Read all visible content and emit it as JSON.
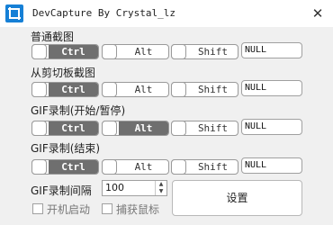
{
  "window": {
    "title": "DevCapture By Crystal_lz",
    "close_glyph": "✕"
  },
  "sections": [
    {
      "label": "普通截图",
      "keys": [
        {
          "label": "Ctrl",
          "on": true
        },
        {
          "label": "Alt",
          "on": false
        },
        {
          "label": "Shift",
          "on": false
        }
      ],
      "key_value": "NULL"
    },
    {
      "label": "从剪切板截图",
      "keys": [
        {
          "label": "Ctrl",
          "on": true
        },
        {
          "label": "Alt",
          "on": false
        },
        {
          "label": "Shift",
          "on": false
        }
      ],
      "key_value": "NULL"
    },
    {
      "label": "GIF录制(开始/暂停)",
      "keys": [
        {
          "label": "Ctrl",
          "on": true
        },
        {
          "label": "Alt",
          "on": true
        },
        {
          "label": "Shift",
          "on": false
        }
      ],
      "key_value": "NULL"
    },
    {
      "label": "GIF录制(结束)",
      "keys": [
        {
          "label": "Ctrl",
          "on": true
        },
        {
          "label": "Alt",
          "on": false
        },
        {
          "label": "Shift",
          "on": false
        }
      ],
      "key_value": "NULL"
    }
  ],
  "gif_interval": {
    "label": "GIF录制间隔",
    "value": "100"
  },
  "checkboxes": [
    {
      "label": "开机启动",
      "checked": false
    },
    {
      "label": "捕获鼠标",
      "checked": false
    }
  ],
  "settings_button": "设置",
  "colors": {
    "toggle_on": "#6f6f6f",
    "app_icon": "#1680d6",
    "title_bar": "#ffffff",
    "window_bg": "#f0f0f0"
  }
}
